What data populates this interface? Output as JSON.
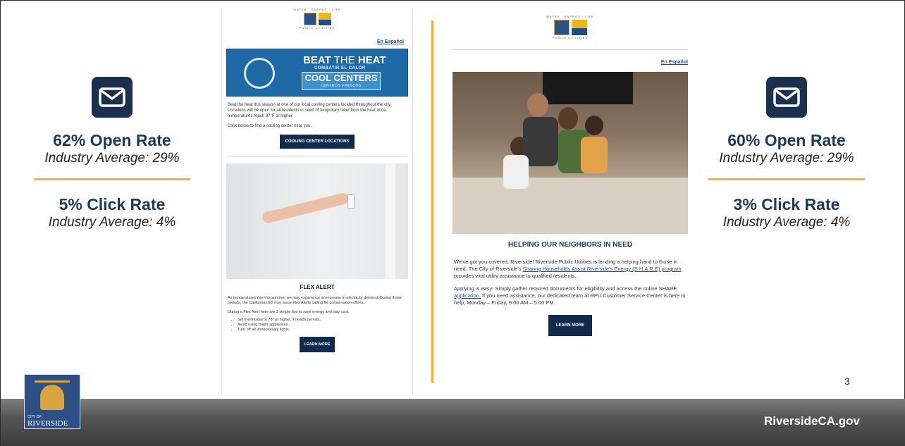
{
  "left_stats": {
    "open_rate": "62% Open Rate",
    "open_avg": "Industry Average: 29%",
    "click_rate": "5% Click Rate",
    "click_avg": "Industry Average: 4%"
  },
  "right_stats": {
    "open_rate": "60% Open Rate",
    "open_avg": "Industry Average: 29%",
    "click_rate": "3% Click Rate",
    "click_avg": "Industry Average: 4%"
  },
  "logo": {
    "tagline": "WATER · ENERGY · LIFE",
    "name": "PUBLIC UTILITIES",
    "city": "RIVERSIDE"
  },
  "email1": {
    "espanol": "En Español",
    "banner_title_a": "BEAT",
    "banner_title_b": " THE ",
    "banner_title_c": "HEAT",
    "banner_es": "COMBATIR EL CALOR",
    "cool_centers": "COOL CENTERS",
    "cool_centers_es": "CENTROS FRESCOS",
    "intro": "Beat the heat this season at one of our local cooling centers located throughout the city. Locations will be open for all residents in need of temporary relief from the heat once temperatures reach 97°F or higher.",
    "click_line": "Click below to find a cooling center near you.",
    "cooling_button": "COOLING CENTER LOCATIONS",
    "flex_title": "FLEX ALERT",
    "flex_body": "As temperatures rise this summer we may experience an increase in electricity demand. During these periods, the California ISO may issue Flex Alerts calling for conservation efforts.",
    "tips_intro": "During a Flex Alert here are 3 simple tips to save energy and stay cool.",
    "tips": [
      "Set thermostat to 78° or higher, if health permits.",
      "Avoid using major appliances.",
      "Turn off all unnecessary lights."
    ],
    "learn_more": "LEARN MORE"
  },
  "email2": {
    "espanol": "En Español",
    "title": "HELPING OUR NEIGHBORS IN NEED",
    "p1_a": "We've got you covered, Riverside! Riverside Public Utilities is lending a helping hand to those in need. The City of Riverside's ",
    "p1_link": "Sharing Households Assist Riverside's Energy (S.H.A.R.E) program",
    "p1_b": " provides vital utility assistance to qualified residents.",
    "p2_a": "Applying is easy! Simply gather required documents for eligibility and access the online SHARE ",
    "p2_link": "application.",
    "p2_b": " If you need assistance, our dedicated team at RPU Customer Service Center is here to help, Monday – Friday, 9:00 AM – 5:00 PM.",
    "learn_more": "LEARN MORE"
  },
  "page_number": "3",
  "footer": {
    "url": "RiversideCA.gov",
    "seal_city_of": "CITY OF",
    "seal_city": "RIVERSIDE"
  },
  "colors": {
    "navy": "#1b2f4f",
    "gold": "#f0b030",
    "button": "#0f2a4d",
    "link": "#1d4e89"
  }
}
